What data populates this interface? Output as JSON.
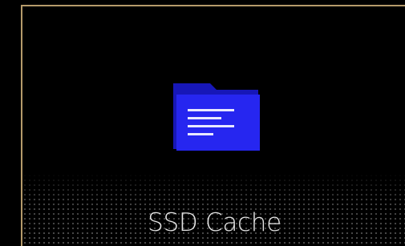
{
  "tile": {
    "label": "SSD Cache",
    "icon": "folder-document-icon",
    "icon_color": "#1f1fe8",
    "border_color": "#b59a6a",
    "label_color": "#e6e6e6",
    "background": "#000000"
  }
}
